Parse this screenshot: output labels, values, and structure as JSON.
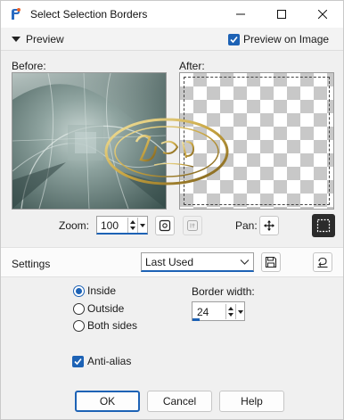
{
  "window": {
    "title": "Select Selection Borders"
  },
  "preview": {
    "label": "Preview",
    "preview_on_image_label": "Preview on Image",
    "preview_on_image_checked": true
  },
  "panes": {
    "before_label": "Before:",
    "after_label": "After:"
  },
  "zoom": {
    "label": "Zoom:",
    "value": "100"
  },
  "pan": {
    "label": "Pan:"
  },
  "settings": {
    "label": "Settings",
    "selected": "Last Used"
  },
  "options": {
    "inside_label": "Inside",
    "outside_label": "Outside",
    "both_label": "Both sides",
    "selected": "Inside",
    "border_width_label": "Border width:",
    "border_width_value": "24",
    "anti_alias_label": "Anti-alias",
    "anti_alias_checked": true
  },
  "buttons": {
    "ok": "OK",
    "cancel": "Cancel",
    "help": "Help"
  },
  "icons": {
    "app": "paint-shop-pro-icon",
    "minimize": "minimize-icon",
    "maximize": "maximize-icon",
    "close": "close-icon",
    "collapse": "triangle-down-icon",
    "zoom_fit": "zoom-to-fit-icon",
    "zoom_one": "actual-size-icon",
    "pan": "move-arrows-icon",
    "marquee": "marquee-selection-icon",
    "save": "save-disk-icon",
    "reset": "reset-icon"
  },
  "colors": {
    "accent": "#1d62b5",
    "window_bg": "#f0f0f0"
  }
}
